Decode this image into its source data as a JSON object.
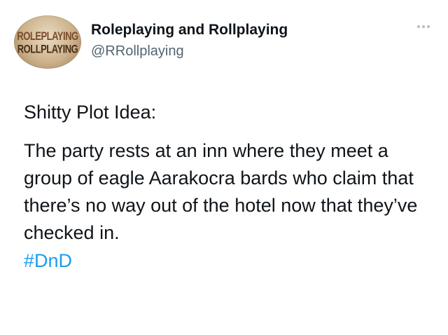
{
  "tweet": {
    "display_name": "Roleplaying and Rollplaying",
    "handle": "@RRollplaying",
    "avatar_lines": [
      "ROLEPLAYING",
      "ROLLPLAYING"
    ],
    "body_title": "Shitty Plot Idea:",
    "body_paragraph": "The party rests at an inn where they meet a group of eagle Aarakocra bards who claim that there’s no way out of the hotel now that they’ve checked in.",
    "hashtag": "#DnD"
  },
  "icons": {
    "more": "more-dots-icon",
    "avatar": "logo-avatar"
  },
  "colors": {
    "link": "#1d9bf0",
    "muted": "#536471",
    "text": "#0f1419"
  }
}
